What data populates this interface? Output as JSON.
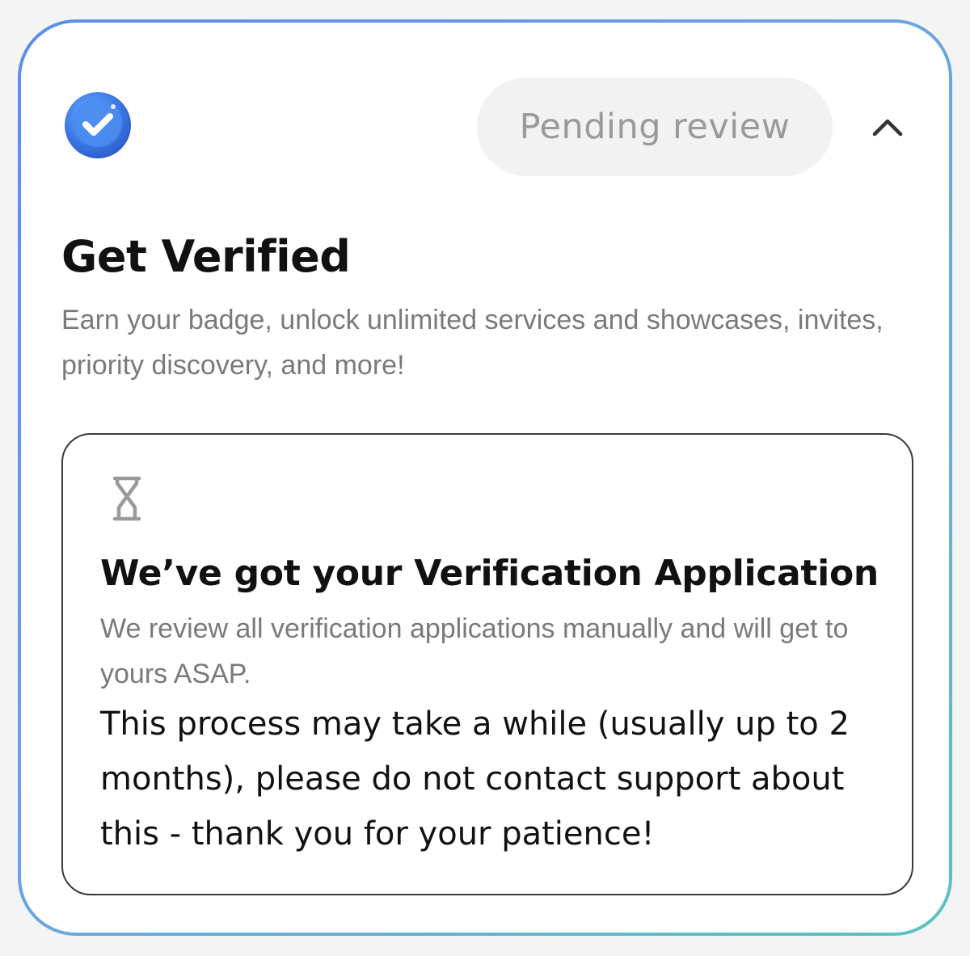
{
  "header": {
    "badge_icon": "verified-badge-icon",
    "status_pill": "Pending review",
    "collapse_icon": "chevron-up-icon"
  },
  "section": {
    "title": "Get Verified",
    "subtitle": "Earn your badge, unlock unlimited services and showcases, invites, priority discovery, and more!"
  },
  "status_card": {
    "icon": "hourglass-icon",
    "title": "We’ve got your Verification Application",
    "description": "We review all verification applications manually and will get to yours ASAP.",
    "note": "This process may take a while (usually up to 2 months), please do not contact support about this - thank you for your patience!"
  },
  "colors": {
    "accent_blue": "#4a86e8",
    "border_gradient_start": "#5a8fe6",
    "border_gradient_end": "#5bc3c0",
    "pill_bg": "#f2f2f3",
    "muted_text": "#7a7a7a"
  }
}
